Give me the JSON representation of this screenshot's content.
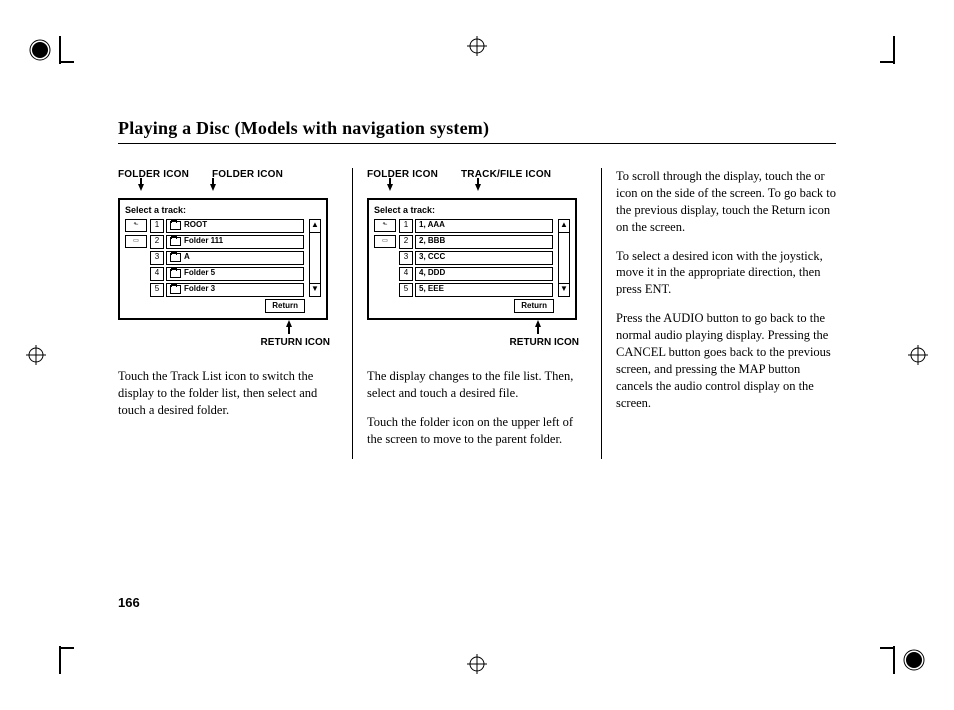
{
  "title": "Playing a Disc (Models with navigation system)",
  "page_number": "166",
  "figure1": {
    "callout_left": "FOLDER ICON",
    "callout_right": "FOLDER ICON",
    "callout_bottom": "RETURN ICON",
    "screen_title": "Select a track:",
    "rows": [
      {
        "n": "1",
        "label": "ROOT",
        "folder": true
      },
      {
        "n": "2",
        "label": "Folder 111",
        "folder": true
      },
      {
        "n": "3",
        "label": "A",
        "folder": true
      },
      {
        "n": "4",
        "label": "Folder 5",
        "folder": true
      },
      {
        "n": "5",
        "label": "Folder 3",
        "folder": true
      }
    ],
    "return_label": "Return"
  },
  "figure2": {
    "callout_left": "FOLDER ICON",
    "callout_right": "TRACK/FILE ICON",
    "callout_bottom": "RETURN ICON",
    "screen_title": "Select a track:",
    "rows": [
      {
        "n": "1",
        "label": "1, AAA"
      },
      {
        "n": "2",
        "label": "2, BBB"
      },
      {
        "n": "3",
        "label": "3, CCC"
      },
      {
        "n": "4",
        "label": "4, DDD"
      },
      {
        "n": "5",
        "label": "5, EEE"
      }
    ],
    "return_label": "Return"
  },
  "col1": {
    "p1": "Touch the Track List icon to switch the display to the folder list, then select and touch a desired folder."
  },
  "col2": {
    "p1": "The display changes to the file list. Then, select and touch a desired file.",
    "p2": "Touch the folder icon on the upper left of the screen to move to the parent folder."
  },
  "col3": {
    "p1": "To scroll through the display, touch the      or      icon on the side of the screen. To go back to the previous display, touch the Return icon on the screen.",
    "p2": "To select a desired icon with the joystick, move it in the appropriate direction, then press ENT.",
    "p3": "Press the AUDIO button to go back to the normal audio playing display. Pressing the CANCEL button goes back to the previous screen, and pressing the MAP button cancels the audio control display on the screen."
  }
}
